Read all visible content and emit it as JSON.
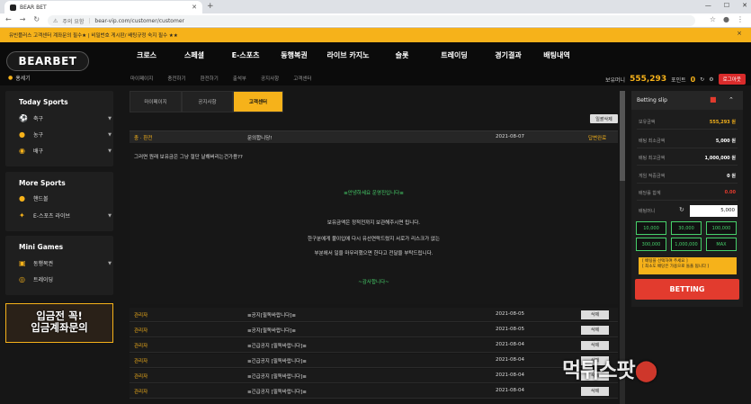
{
  "browser": {
    "tab_title": "BEAR BET",
    "address_warning": "주의 요함",
    "url": "bear-vip.com/customer/customer"
  },
  "notice": {
    "text": "유빈플러스 고객센터 계좌문의 필수★ | 비밀번호 게시판/ 배팅규정 숙지 필수 ★★",
    "close": "×"
  },
  "header": {
    "logo": "BEARBET",
    "main_nav": [
      "크로스",
      "스페셜",
      "E-스포츠",
      "동행복권",
      "라이브 카지노",
      "슬롯",
      "트레이딩",
      "경기결과",
      "배팅내역"
    ],
    "sub_nav": [
      "마이페이지",
      "충전하기",
      "환전하기",
      "출석부",
      "공지사항",
      "고객센터"
    ],
    "user_name": "홍세기",
    "balance_label": "보유머니",
    "balance": "555,293",
    "point_label": "포인트",
    "points": "0",
    "logout": "로그아웃"
  },
  "sidebar": {
    "today_title": "Today Sports",
    "today_items": [
      {
        "label": "축구",
        "icon": "soccer-ball-icon"
      },
      {
        "label": "농구",
        "icon": "basketball-icon"
      },
      {
        "label": "배구",
        "icon": "volleyball-icon"
      }
    ],
    "more_title": "More Sports",
    "more_items": [
      {
        "label": "핸드볼",
        "icon": "handball-icon"
      },
      {
        "label": "E-스포츠 라이브",
        "icon": "esports-icon"
      }
    ],
    "mini_title": "Mini Games",
    "mini_items": [
      {
        "label": "동행복권",
        "icon": "lottery-icon"
      },
      {
        "label": "트레이딩",
        "icon": "trading-icon"
      }
    ],
    "banner_line1": "입금전 꼭!",
    "banner_line2": "입금계좌문의"
  },
  "content": {
    "tabs": [
      "마이페이지",
      "공지사항",
      "고객센터"
    ],
    "active_tab": "고객센터",
    "list_delete_btn": "일괄삭제",
    "message": {
      "category": "충 · 환전",
      "title": "문의합니당!",
      "date": "2021-08-07",
      "status": "답변완료",
      "question": "그러면 원래 보유금은 그냥 절단 날해버리는건가용??",
      "reply_greeting": "≡안녕하세요 운영진입니다≡",
      "reply_line1": "보유금액은 정적전까지 보관해주시면 됩니다.",
      "reply_line2": "한구분에게 불이입에 다시 유선연락드렸지 서로가 리스크가 없는",
      "reply_line3": "부분에서 일을 마무리했으면 한다고 전달을 부탁드립니다.",
      "reply_thanks": "~감사합니다~"
    },
    "rows": [
      {
        "author": "관리자",
        "title": "≡공지[필독바랍니다]≡",
        "date": "2021-08-05",
        "action": "삭제"
      },
      {
        "author": "관리자",
        "title": "≡공지[필독바랍니다]≡",
        "date": "2021-08-05",
        "action": "삭제"
      },
      {
        "author": "관리자",
        "title": "≡긴급공지 [필독바랍니다]≡",
        "date": "2021-08-04",
        "action": "삭제"
      },
      {
        "author": "관리자",
        "title": "≡긴급공지 [필독바랍니다]≡",
        "date": "2021-08-04",
        "action": "삭제"
      },
      {
        "author": "관리자",
        "title": "≡긴급공지 [필독바랍니다]≡",
        "date": "2021-08-04",
        "action": "삭제"
      },
      {
        "author": "관리자",
        "title": "≡긴급공지 [필독바랍니다]≡",
        "date": "2021-08-04",
        "action": "삭제"
      }
    ]
  },
  "betslip": {
    "title": "Betting slip",
    "rows": [
      {
        "label": "보유금액",
        "value": "555,293 원"
      },
      {
        "label": "배팅 최소금액",
        "value": "5,000 원"
      },
      {
        "label": "배팅 최고금액",
        "value": "1,000,000 원"
      },
      {
        "label": "게임 적중금액",
        "value": "0 원"
      },
      {
        "label": "배당률 합계",
        "value": "0.00"
      }
    ],
    "amount_label": "배팅머니",
    "amount_value": "5,000",
    "chips": [
      "10,000",
      "30,000",
      "100,000",
      "300,000",
      "1,000,000",
      "MAX"
    ],
    "note_line1": "[ 배팅을 선택하여 주세요 ]",
    "note_line2": "[ 최소도 배당은 가용으로 돌풀 됩니다 ]",
    "bet_button": "BETTING"
  },
  "watermark": {
    "text": "먹튀스팟"
  }
}
